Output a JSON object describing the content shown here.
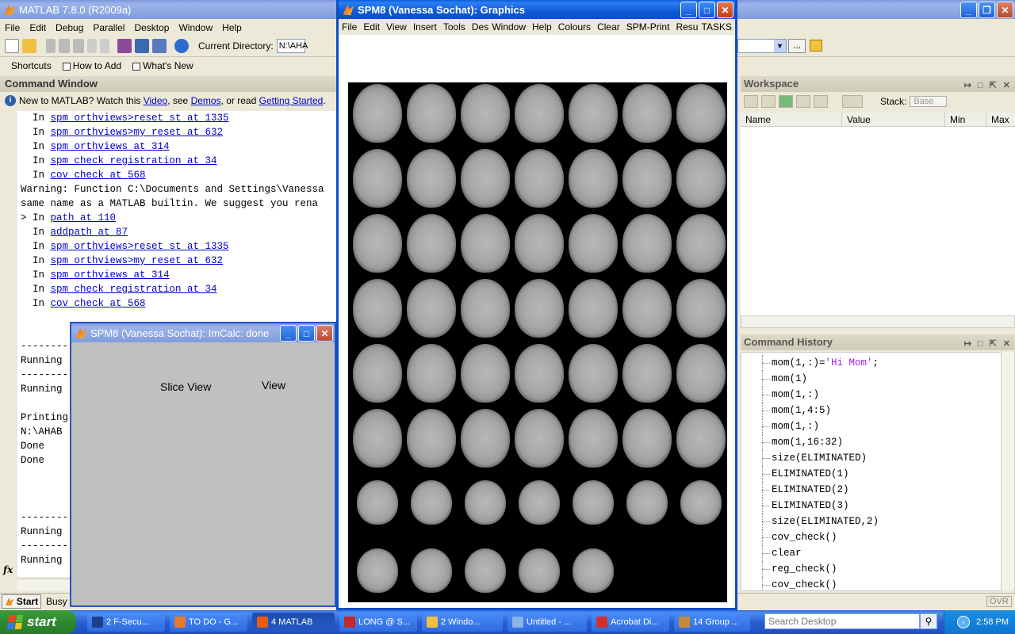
{
  "matlab": {
    "title": "MATLAB  7.8.0 (R2009a)",
    "menu": [
      "File",
      "Edit",
      "Debug",
      "Parallel",
      "Desktop",
      "Window",
      "Help"
    ],
    "current_directory_label": "Current Directory:",
    "current_directory_value": "N:\\AHA",
    "shortcuts": [
      "Shortcuts",
      "How to Add",
      "What's New"
    ]
  },
  "command_window": {
    "title": "Command Window",
    "info_prefix": "New to MATLAB? Watch this ",
    "info_video": "Video",
    "info_mid1": ", see ",
    "info_demos": "Demos",
    "info_mid2": ", or read ",
    "info_getting_started": "Getting Started",
    "info_end": ".",
    "lines": [
      {
        "prefix": "  In ",
        "link": "spm_orthviews>reset_st at 1335",
        "text": ""
      },
      {
        "prefix": "  In ",
        "link": "spm_orthviews>my_reset at 632",
        "text": ""
      },
      {
        "prefix": "  In ",
        "link": "spm_orthviews at 314",
        "text": ""
      },
      {
        "prefix": "  In ",
        "link": "spm_check_registration at 34",
        "text": ""
      },
      {
        "prefix": "  In ",
        "link": "cov_check at 568",
        "text": ""
      },
      {
        "prefix": "",
        "link": "",
        "text": "Warning: Function C:\\Documents and Settings\\Vanessa"
      },
      {
        "prefix": "",
        "link": "",
        "text": "same name as a MATLAB builtin. We suggest you rena"
      },
      {
        "prefix": "> In ",
        "link": "path at 110",
        "text": ""
      },
      {
        "prefix": "  In ",
        "link": "addpath at 87",
        "text": ""
      },
      {
        "prefix": "  In ",
        "link": "spm_orthviews>reset_st at 1335",
        "text": ""
      },
      {
        "prefix": "  In ",
        "link": "spm_orthviews>my_reset at 632",
        "text": ""
      },
      {
        "prefix": "  In ",
        "link": "spm_orthviews at 314",
        "text": ""
      },
      {
        "prefix": "  In ",
        "link": "spm_check_registration at 34",
        "text": ""
      },
      {
        "prefix": "  In ",
        "link": "cov_check at 568",
        "text": ""
      },
      {
        "prefix": "",
        "link": "",
        "text": ""
      },
      {
        "prefix": "",
        "link": "",
        "text": ""
      },
      {
        "prefix": "",
        "link": "",
        "text": "--------"
      },
      {
        "prefix": "",
        "link": "",
        "text": "Running"
      },
      {
        "prefix": "",
        "link": "",
        "text": "--------"
      },
      {
        "prefix": "",
        "link": "",
        "text": "Running"
      },
      {
        "prefix": "",
        "link": "",
        "text": ""
      },
      {
        "prefix": "",
        "link": "",
        "text": "Printing"
      },
      {
        "prefix": "",
        "link": "",
        "text": "N:\\AHAB"
      },
      {
        "prefix": "",
        "link": "",
        "text": "Done"
      },
      {
        "prefix": "",
        "link": "",
        "text": "Done"
      },
      {
        "prefix": "",
        "link": "",
        "text": ""
      },
      {
        "prefix": "",
        "link": "",
        "text": ""
      },
      {
        "prefix": "",
        "link": "",
        "text": ""
      },
      {
        "prefix": "",
        "link": "",
        "text": "--------"
      },
      {
        "prefix": "",
        "link": "",
        "text": "Running"
      },
      {
        "prefix": "",
        "link": "",
        "text": "--------"
      },
      {
        "prefix": "",
        "link": "",
        "text": "Running"
      }
    ],
    "fx": "fx"
  },
  "status_bar": {
    "start_label": "Start",
    "status": "Busy",
    "ovr": "OVR"
  },
  "workspace": {
    "title": "Workspace",
    "stack_label": "Stack:",
    "stack_value": "Base",
    "columns": [
      "Name",
      "Value",
      "Min",
      "Max"
    ]
  },
  "history": {
    "title": "Command History",
    "lines": [
      {
        "code": "mom(1,:)=",
        "str": "'Hi Mom'",
        "tail": ";"
      },
      {
        "code": "mom(1)",
        "str": "",
        "tail": ""
      },
      {
        "code": "mom(1,:)",
        "str": "",
        "tail": ""
      },
      {
        "code": "mom(1,4:5)",
        "str": "",
        "tail": ""
      },
      {
        "code": "mom(1,:)",
        "str": "",
        "tail": ""
      },
      {
        "code": "mom(1,16:32)",
        "str": "",
        "tail": ""
      },
      {
        "code": "size(ELIMINATED)",
        "str": "",
        "tail": ""
      },
      {
        "code": "ELIMINATED(1)",
        "str": "",
        "tail": ""
      },
      {
        "code": "ELIMINATED(2)",
        "str": "",
        "tail": ""
      },
      {
        "code": "ELIMINATED(3)",
        "str": "",
        "tail": ""
      },
      {
        "code": "size(ELIMINATED,2)",
        "str": "",
        "tail": ""
      },
      {
        "code": "cov_check()",
        "str": "",
        "tail": ""
      },
      {
        "code": "clear",
        "str": "",
        "tail": ""
      },
      {
        "code": "reg_check()",
        "str": "",
        "tail": ""
      },
      {
        "code": "cov_check()",
        "str": "",
        "tail": ""
      }
    ]
  },
  "imcalc": {
    "title": "SPM8 (Vanessa Sochat): ImCalc: done",
    "slice_view": "Slice View",
    "view": "View"
  },
  "graphics": {
    "title": "SPM8 (Vanessa Sochat): Graphics",
    "menu": [
      "File",
      "Edit",
      "View",
      "Insert",
      "Tools",
      "Desktop",
      "Window",
      "Help",
      "Colours",
      "Clear",
      "SPM-Print",
      "Results-Fig",
      "TASKS"
    ]
  },
  "taskbar": {
    "start": "start",
    "buttons": [
      {
        "label": "2 F-Secu...",
        "color": "#1d3f8a"
      },
      {
        "label": "TO DO - G...",
        "color": "#e8782a"
      },
      {
        "label": "4 MATLAB",
        "color": "#e85d0c"
      },
      {
        "label": "LONG @ S...",
        "color": "#c62828"
      },
      {
        "label": "2 Windo...",
        "color": "#f0c040"
      },
      {
        "label": "Untitled - ...",
        "color": "#8ab4e8"
      },
      {
        "label": "Acrobat Di...",
        "color": "#d32f2f"
      },
      {
        "label": "14 Group ...",
        "color": "#c48a3a"
      }
    ],
    "search_placeholder": "Search Desktop",
    "clock": "2:58 PM"
  }
}
